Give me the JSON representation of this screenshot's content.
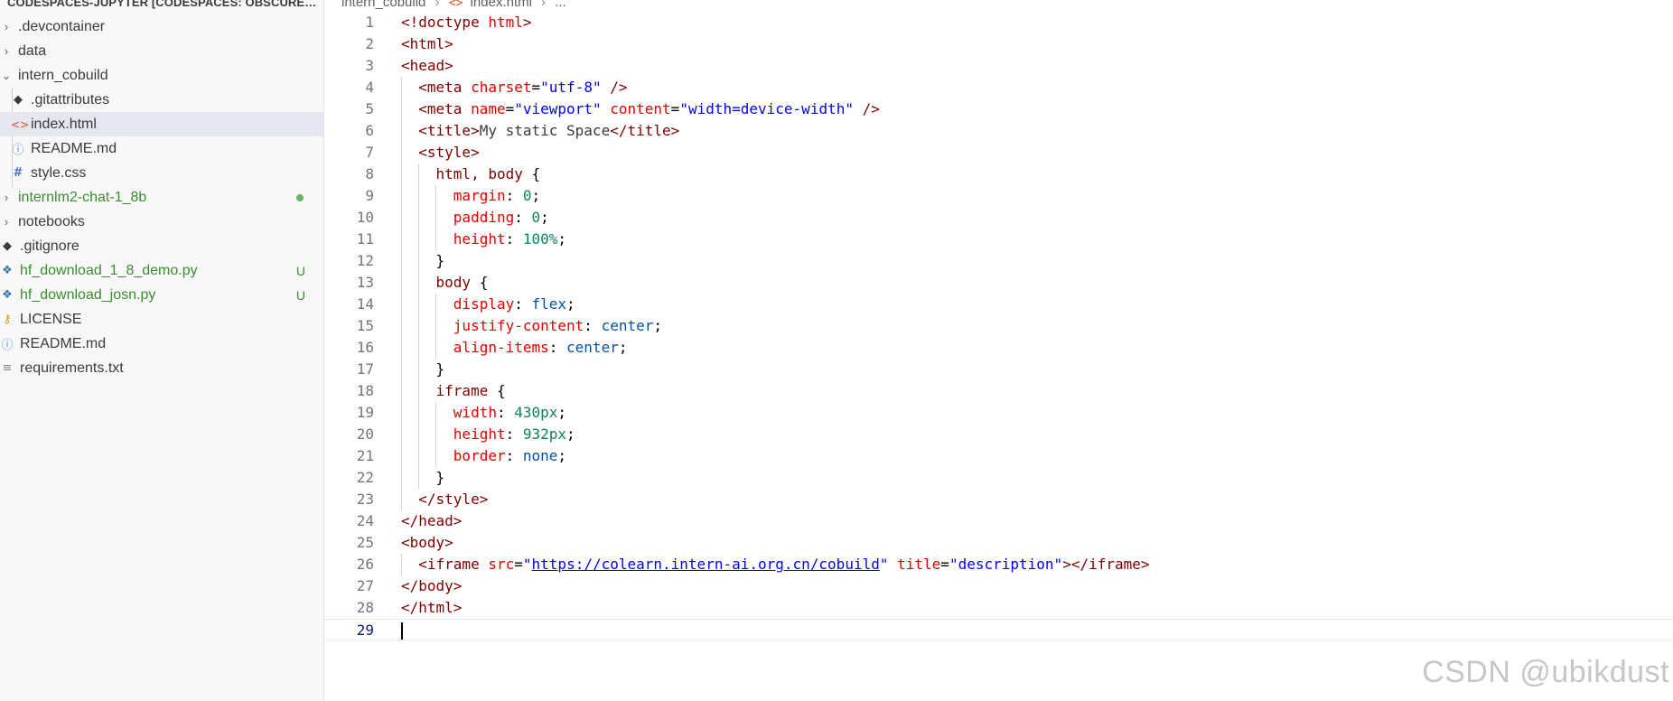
{
  "sidebar": {
    "header": "CODESPACES-JUPYTER [CODESPACES: OBSCURE SP...",
    "items": [
      {
        "label": ".devcontainer",
        "chev": "›",
        "icon": "",
        "iconName": "chevron-right-icon"
      },
      {
        "label": "data",
        "chev": "›",
        "icon": ""
      },
      {
        "label": "intern_cobuild",
        "chev": "⌄",
        "icon": ""
      },
      {
        "label": ".gitattributes",
        "icon": "◆"
      },
      {
        "label": "index.html",
        "icon": "<>"
      },
      {
        "label": "README.md",
        "icon": "ⓘ"
      },
      {
        "label": "style.css",
        "icon": "#"
      },
      {
        "label": "internlm2-chat-1_8b",
        "chev": "›",
        "icon": ""
      },
      {
        "label": "notebooks",
        "chev": "›",
        "icon": ""
      },
      {
        "label": ".gitignore",
        "icon": "◆"
      },
      {
        "label": "hf_download_1_8_demo.py",
        "icon": "❖",
        "badge": "U"
      },
      {
        "label": "hf_download_josn.py",
        "icon": "❖",
        "badge": "U"
      },
      {
        "label": "LICENSE",
        "icon": "⚷"
      },
      {
        "label": "README.md",
        "icon": "ⓘ"
      },
      {
        "label": "requirements.txt",
        "icon": "≡"
      }
    ]
  },
  "breadcrumb": {
    "folder": "intern_cobuild",
    "file": "index.html",
    "more": "..."
  },
  "editor": {
    "current_line": 29,
    "lines": [
      "<!doctype html>",
      "<html>",
      "<head>",
      "  <meta charset=\"utf-8\" />",
      "  <meta name=\"viewport\" content=\"width=device-width\" />",
      "  <title>My static Space</title>",
      "  <style>",
      "    html, body {",
      "      margin: 0;",
      "      padding: 0;",
      "      height: 100%;",
      "    }",
      "    body {",
      "      display: flex;",
      "      justify-content: center;",
      "      align-items: center;",
      "    }",
      "    iframe {",
      "      width: 430px;",
      "      height: 932px;",
      "      border: none;",
      "    }",
      "  </style>",
      "</head>",
      "<body>",
      "  <iframe src=\"https://colearn.intern-ai.org.cn/cobuild\" title=\"description\"></iframe>",
      "</body>",
      "</html>",
      ""
    ]
  },
  "watermark": "CSDN @ubikdust",
  "colors": {
    "tag": "#800000",
    "attr": "#e50000",
    "string": "#0000ff",
    "number": "#098658",
    "keyword": "#0451a5",
    "git_untracked": "#3a8d2f",
    "selection": "#e4e6f1"
  }
}
